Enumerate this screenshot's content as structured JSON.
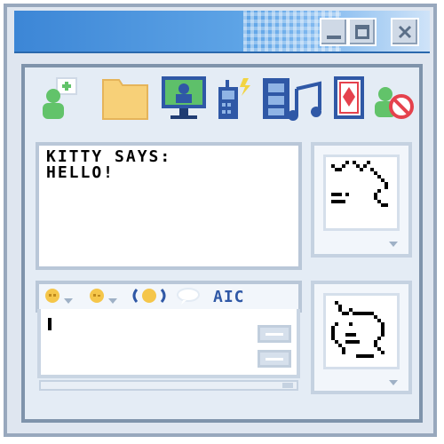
{
  "window": {
    "message": "KITTY SAYS:\nHELLO!",
    "format_label": "AIC"
  },
  "icons": [
    "add-contact-icon",
    "folder-icon",
    "remote-desktop-icon",
    "mobile-icon",
    "media-music-icon",
    "card-icon",
    "block-contact-icon"
  ],
  "colors": {
    "accent": "#3c86d6",
    "frame": "#98a8bd",
    "panel_border": "#b9c7d8"
  }
}
